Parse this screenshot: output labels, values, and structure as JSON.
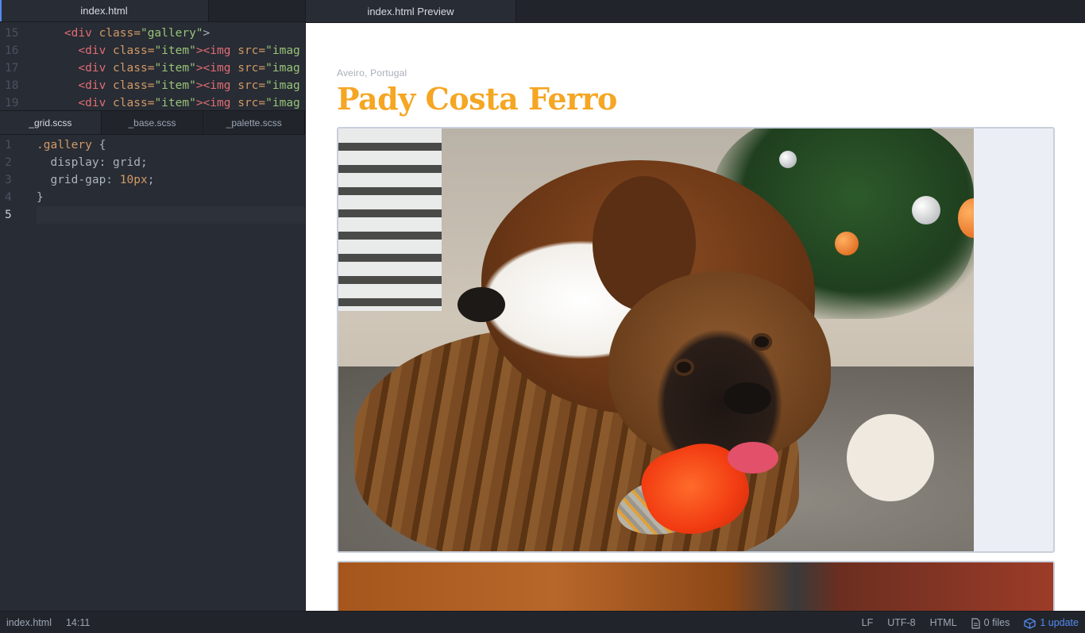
{
  "editor_top": {
    "tabs": [
      {
        "label": "index.html",
        "active": true
      }
    ],
    "lines": [
      {
        "num": "15"
      },
      {
        "num": "16"
      },
      {
        "num": "17"
      },
      {
        "num": "18"
      },
      {
        "num": "19"
      }
    ],
    "code": {
      "gallery_div_open": "<div",
      "class_attr": "class=",
      "gallery_str": "\"gallery\"",
      "close_angle": ">",
      "item_div_open": "<div",
      "item_str": "\"item\"",
      "img_open": "><img",
      "src_attr": "src=",
      "src_partial": "\"imag"
    }
  },
  "editor_scss": {
    "tabs": [
      {
        "label": "_grid.scss",
        "active": true
      },
      {
        "label": "_base.scss",
        "active": false
      },
      {
        "label": "_palette.scss",
        "active": false
      }
    ],
    "lines": [
      {
        "num": "1",
        "selector": ".gallery",
        "brace": " {"
      },
      {
        "num": "2",
        "prop": "display:",
        "value": " grid;"
      },
      {
        "num": "3",
        "prop": "grid-gap:",
        "num_value": " 10px",
        "semi": ";"
      },
      {
        "num": "4",
        "brace": "}"
      },
      {
        "num": "5"
      }
    ]
  },
  "preview": {
    "tab_label": "index.html Preview",
    "location": "Aveiro, Portugal",
    "title": "Pady Costa Ferro",
    "accent_color": "#f5a623"
  },
  "status_bar": {
    "file": "index.html",
    "cursor": "14:11",
    "line_ending": "LF",
    "encoding": "UTF-8",
    "grammar": "HTML",
    "files_label": "0 files",
    "update_label": "1 update",
    "files_icon": "file-icon",
    "update_icon": "package-icon"
  }
}
